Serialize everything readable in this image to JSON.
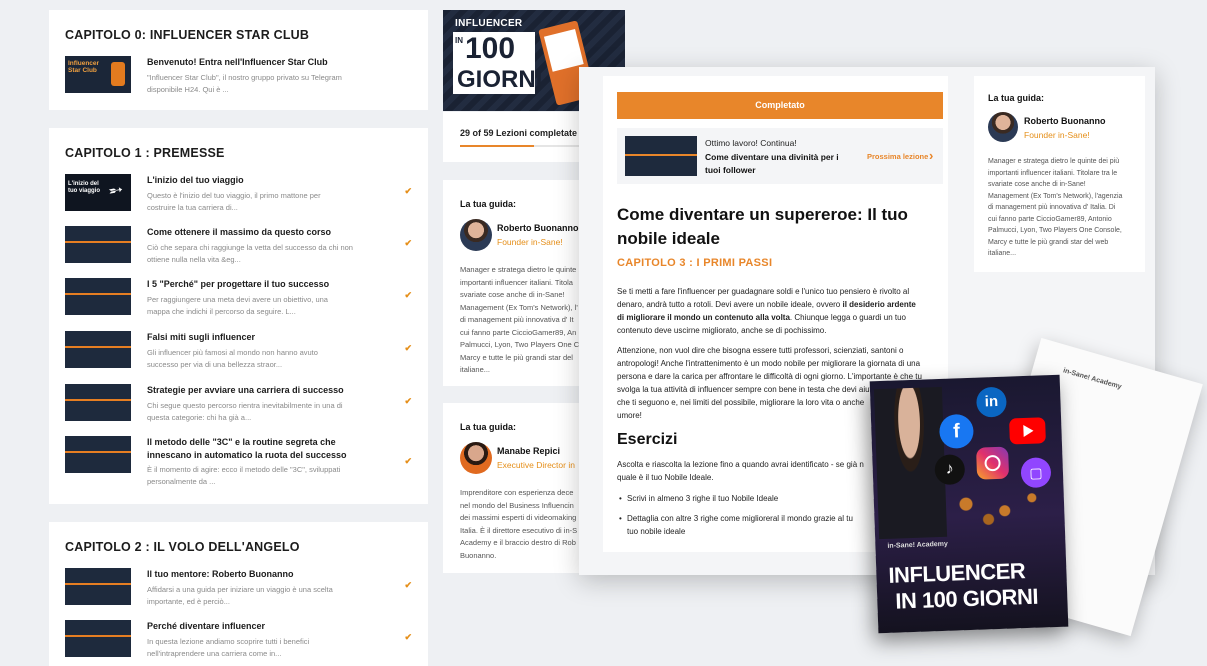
{
  "left": {
    "ch0": {
      "title": "CAPITOLO 0: INFLUENCER STAR CLUB",
      "lessons": [
        {
          "title": "Benvenuto! Entra nell'Influencer Star Club",
          "desc1": "\"Influencer Star Club\", il nostro gruppo privato su Telegram",
          "desc2": "disponibile H24. Qui è ...",
          "thumb": "Influencer Star Club"
        }
      ]
    },
    "ch1": {
      "title": "CAPITOLO 1 : PREMESSE",
      "lessons": [
        {
          "title": "L'inizio del tuo viaggio",
          "desc1": "Questo è l'inizio del tuo viaggio, il primo mattone per",
          "desc2": "costruire la tua carriera di...",
          "thumb": "L'inizio del tuo viaggio"
        },
        {
          "title": "Come ottenere il massimo da questo corso",
          "desc1": "Ciò che separa chi raggiunge la vetta del successo da chi non",
          "desc2": "ottiene nulla nella vita &eg..."
        },
        {
          "title": "I 5 \"Perché\" per progettare il tuo successo",
          "desc1": "Per raggiungere una meta devi avere un obiettivo, una",
          "desc2": "mappa che indichi il percorso da seguire. L..."
        },
        {
          "title": "Falsi miti sugli influencer",
          "desc1": "Gli influencer più famosi al mondo non hanno avuto",
          "desc2": "successo per via di una bellezza straor..."
        },
        {
          "title": "Strategie per avviare una carriera di successo",
          "desc1": "Chi segue questo percorso rientra inevitabilmente in una di",
          "desc2": "questa categorie: chi ha già a..."
        },
        {
          "title": "Il metodo delle \"3C\" e la routine segreta che",
          "title2": "innescano in automatico la ruota del successo",
          "desc1": "È il momento di agire: ecco il metodo delle \"3C\", sviluppati",
          "desc2": "personalmente da ..."
        }
      ]
    },
    "ch2": {
      "title": "CAPITOLO 2 : IL VOLO DELL'ANGELO",
      "lessons": [
        {
          "title": "Il tuo mentore: Roberto Buonanno",
          "desc1": "Affidarsi a una guida per iniziare un viaggio è una scelta",
          "desc2": "importante, ed è perciò..."
        },
        {
          "title": "Perché diventare influencer",
          "desc1": "In questa lezione andiamo scoprire tutti i benefici",
          "desc2": "nell'intraprendere una carriera come in..."
        }
      ]
    }
  },
  "middle": {
    "hero": {
      "line1": "INFLUENCER",
      "in": "IN",
      "num": "100",
      "giorni": "GIORNI"
    },
    "progress": "29 of 59 Lezioni completate",
    "guide1": {
      "header": "La tua guida:",
      "name": "Roberto Buonanno",
      "role": "Founder in-Sane!",
      "bio": [
        "Manager e stratega dietro le quinte",
        "importanti influencer italiani. Titola",
        "svariate cose anche di in-Sane!",
        "Management (Ex Tom's Network), l'",
        "di management più innovativa d' It",
        "cui fanno parte CiccioGamer89, An",
        "Palmucci, Lyon, Two Players One C",
        "Marcy e tutte le più grandi star del",
        "italiane..."
      ]
    },
    "guide2": {
      "header": "La tua guida:",
      "name": "Manabe Repici",
      "role": "Executive Director in",
      "bio": [
        "Imprenditore con esperienza dece",
        "nel mondo del Business Influencin",
        "dei massimi esperti di videomaking",
        "Italia. È il direttore esecutivo di in-S",
        "Academy e il braccio destro di Rob",
        "Buonanno."
      ]
    }
  },
  "lesson": {
    "completed": "Completato",
    "next": {
      "pre": "Ottimo lavoro! Continua!",
      "title1": "Come diventare una divinità per i",
      "title2": "tuoi follower",
      "link": "Prossima lezione",
      "arrow": "›"
    },
    "title1": "Come diventare un supereroe: Il tuo",
    "title2": "nobile ideale",
    "chapter": "CAPITOLO 3 : I PRIMI PASSI",
    "p1": [
      "Se ti metti a fare l'influencer per guadagnare soldi e l'unico tuo pensiero è rivolto al",
      "denaro, andrà tutto a rotoli. Devi avere un nobile ideale, ovvero ",
      "il desiderio ardente",
      "di migliorare il mondo un contenuto alla volta",
      ". Chiunque legga o guardi un tuo",
      "contenuto deve uscirne migliorato, anche se di pochissimo."
    ],
    "p2": [
      "Attenzione, non vuol dire che bisogna essere tutti professori, scienziati, santoni o",
      "antropologi! Anche l'intrattenimento è un modo nobile per migliorare la giornata di una",
      "persona e dare la carica per affrontare le difficoltà di ogni giorno. L'importante è che tu",
      "svolga la tua attività di influencer sempre con bene in testa che devi aiutare le persone",
      "che ti seguono e, nei limiti del possibile, migliorare la loro vita o anche",
      "umore!"
    ],
    "ex_title": "Esercizi",
    "ex_intro": [
      "Ascolta e riascolta la lezione fino a quando avrai identificato - se già n",
      "quale è il tuo Nobile Ideale."
    ],
    "bullets": [
      [
        "Scrivi in almeno 3 righe il tuo Nobile Ideale"
      ],
      [
        "Dettaglia con altre 3 righe come miglioreral il mondo grazie al tu",
        "tuo nobile ideale"
      ]
    ],
    "sidebar": {
      "header": "La tua guida:",
      "name": "Roberto Buonanno",
      "role": "Founder in-Sane!",
      "bio": [
        "Manager e stratega dietro le quinte dei più",
        "importanti influencer italiani. Titolare tra le",
        "svariate cose anche di in-Sane!",
        "Management (Ex Tom's Network), l'agenzia",
        "di management più innovativa d' Italia. Di",
        "cui fanno parte CiccioGamer89, Antonio",
        "Palmucci, Lyon, Two Players One Console,",
        "Marcy e tutte le più grandi star del web",
        "italiane..."
      ]
    }
  },
  "book": {
    "brand": "in-Sane! Academy",
    "paper_brand": "in-Sane! Academy",
    "title1": "INFLUENCER",
    "title2": "IN 100 GIORNI",
    "icons": [
      "linkedin-icon",
      "facebook-icon",
      "youtube-icon",
      "tiktok-icon",
      "instagram-icon",
      "twitch-icon"
    ]
  },
  "colors": {
    "accent": "#e8862a",
    "navy": "#1e2a3d"
  }
}
